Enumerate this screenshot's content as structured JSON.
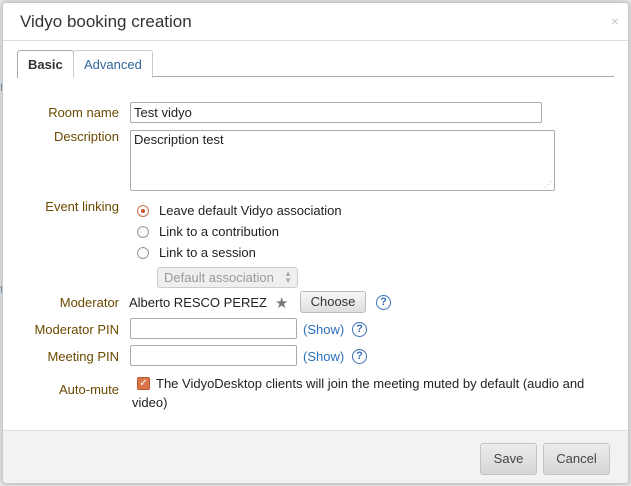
{
  "dialog": {
    "title": "Vidyo booking creation",
    "close_glyph": "×"
  },
  "tabs": [
    {
      "label": "Basic",
      "active": true
    },
    {
      "label": "Advanced",
      "active": false
    }
  ],
  "form": {
    "room_name": {
      "label": "Room name",
      "value": "Test vidyo"
    },
    "description": {
      "label": "Description",
      "value": "Description test"
    },
    "event_linking": {
      "label": "Event linking",
      "options": [
        {
          "label": "Leave default Vidyo association",
          "checked": true
        },
        {
          "label": "Link to a contribution",
          "checked": false
        },
        {
          "label": "Link to a session",
          "checked": false
        }
      ],
      "association_select": {
        "value": "Default association",
        "disabled": true
      }
    },
    "moderator": {
      "label": "Moderator",
      "value": "Alberto RESCO PEREZ",
      "choose_label": "Choose",
      "star_icon": "star-icon"
    },
    "moderator_pin": {
      "label": "Moderator PIN",
      "value": "",
      "show_label": "(Show)"
    },
    "meeting_pin": {
      "label": "Meeting PIN",
      "value": "",
      "show_label": "(Show)"
    },
    "auto_mute": {
      "label": "Auto-mute",
      "checked": true,
      "text": "The VidyoDesktop clients will join the meeting muted by default (audio and video)"
    },
    "help_glyph": "?"
  },
  "footer": {
    "save_label": "Save",
    "cancel_label": "Cancel"
  },
  "colors": {
    "label": "#6b4a00",
    "link": "#2a6fbb",
    "accent": "#d9764a"
  }
}
